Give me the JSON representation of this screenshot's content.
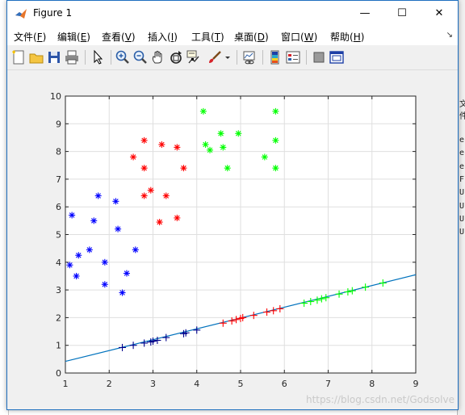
{
  "window": {
    "title": "Figure 1",
    "minimize_glyph": "—",
    "maximize_glyph": "☐",
    "close_glyph": "✕"
  },
  "menu": {
    "items": [
      {
        "label": "文件(",
        "key": "F",
        "tail": ")"
      },
      {
        "label": "编辑(",
        "key": "E",
        "tail": ")"
      },
      {
        "label": "查看(",
        "key": "V",
        "tail": ")"
      },
      {
        "label": "插入(",
        "key": "I",
        "tail": ")"
      },
      {
        "label": "工具(",
        "key": "T",
        "tail": ")"
      },
      {
        "label": "桌面(",
        "key": "D",
        "tail": ")"
      },
      {
        "label": "窗口(",
        "key": "W",
        "tail": ")"
      },
      {
        "label": "帮助(",
        "key": "H",
        "tail": ")"
      }
    ],
    "overflow_glyph": "↘"
  },
  "toolbar": {
    "buttons": [
      "new-figure-icon",
      "open-file-icon",
      "save-icon",
      "print-icon",
      "pointer-icon",
      "zoom-in-icon",
      "zoom-out-icon",
      "pan-hand-icon",
      "rotate-3d-icon",
      "data-cursor-icon",
      "brush-icon",
      "brush-dropdown-icon",
      "link-plot-icon",
      "colorbar-icon",
      "legend-icon",
      "hide-plot-tools-icon",
      "show-plot-tools-icon"
    ]
  },
  "background_right_lines": [
    "e",
    "e",
    "e",
    "F",
    "U",
    "U",
    "U",
    "U"
  ],
  "background_right_top": "文件",
  "watermark": "https://blog.csdn.net/Godsolve",
  "colors": {
    "blue": "#0000ff",
    "red": "#ff0000",
    "green": "#00ff00",
    "line": "#0072bd",
    "projected_blue": "#00008b",
    "title_accent": "#1e6fbf"
  },
  "chart_data": {
    "type": "scatter",
    "title": "",
    "xlabel": "",
    "ylabel": "",
    "xlim": [
      1,
      9
    ],
    "ylim": [
      0,
      10
    ],
    "xticks": [
      "1",
      "2",
      "3",
      "4",
      "5",
      "6",
      "7",
      "8",
      "9"
    ],
    "yticks": [
      "0",
      "1",
      "2",
      "3",
      "4",
      "5",
      "6",
      "7",
      "8",
      "9",
      "10"
    ],
    "grid": true,
    "series": [
      {
        "color": "blue",
        "marker": "*",
        "points": [
          [
            1.1,
            3.9
          ],
          [
            1.15,
            5.7
          ],
          [
            1.25,
            3.5
          ],
          [
            1.3,
            4.25
          ],
          [
            1.55,
            4.45
          ],
          [
            1.65,
            5.5
          ],
          [
            1.75,
            6.4
          ],
          [
            1.9,
            3.2
          ],
          [
            1.9,
            4.0
          ],
          [
            2.15,
            6.2
          ],
          [
            2.2,
            5.2
          ],
          [
            2.3,
            2.9
          ],
          [
            2.4,
            3.6
          ],
          [
            2.6,
            4.45
          ]
        ]
      },
      {
        "color": "red",
        "marker": "*",
        "points": [
          [
            2.55,
            7.8
          ],
          [
            2.8,
            8.4
          ],
          [
            2.8,
            7.4
          ],
          [
            2.8,
            6.4
          ],
          [
            2.95,
            6.6
          ],
          [
            3.15,
            5.45
          ],
          [
            3.2,
            8.25
          ],
          [
            3.3,
            6.4
          ],
          [
            3.55,
            8.15
          ],
          [
            3.55,
            5.6
          ],
          [
            3.7,
            7.4
          ]
        ]
      },
      {
        "color": "green",
        "marker": "*",
        "points": [
          [
            4.15,
            9.45
          ],
          [
            4.2,
            8.25
          ],
          [
            4.3,
            8.05
          ],
          [
            4.55,
            8.65
          ],
          [
            4.6,
            8.15
          ],
          [
            4.7,
            7.4
          ],
          [
            4.95,
            8.65
          ],
          [
            5.55,
            7.8
          ],
          [
            5.8,
            9.45
          ],
          [
            5.8,
            8.4
          ],
          [
            5.8,
            7.4
          ]
        ]
      },
      {
        "color": "projected_blue",
        "marker": "+",
        "points": [
          [
            2.3,
            0.92
          ],
          [
            2.55,
            1.0
          ],
          [
            2.8,
            1.08
          ],
          [
            2.95,
            1.12
          ],
          [
            3.0,
            1.15
          ],
          [
            3.1,
            1.18
          ],
          [
            3.3,
            1.28
          ],
          [
            3.7,
            1.42
          ],
          [
            3.75,
            1.45
          ],
          [
            4.0,
            1.55
          ]
        ]
      },
      {
        "color": "red",
        "marker": "+",
        "points": [
          [
            4.6,
            1.8
          ],
          [
            4.8,
            1.88
          ],
          [
            4.9,
            1.93
          ],
          [
            5.0,
            1.97
          ],
          [
            5.05,
            2.0
          ],
          [
            5.3,
            2.08
          ],
          [
            5.6,
            2.2
          ],
          [
            5.75,
            2.25
          ],
          [
            5.9,
            2.32
          ]
        ]
      },
      {
        "color": "green",
        "marker": "+",
        "points": [
          [
            6.45,
            2.52
          ],
          [
            6.6,
            2.58
          ],
          [
            6.75,
            2.63
          ],
          [
            6.85,
            2.68
          ],
          [
            6.95,
            2.72
          ],
          [
            7.25,
            2.85
          ],
          [
            7.45,
            2.93
          ],
          [
            7.55,
            2.97
          ],
          [
            7.85,
            3.1
          ],
          [
            8.25,
            3.25
          ]
        ]
      }
    ],
    "line": {
      "x": [
        1,
        9
      ],
      "y": [
        0.42,
        3.55
      ]
    }
  }
}
